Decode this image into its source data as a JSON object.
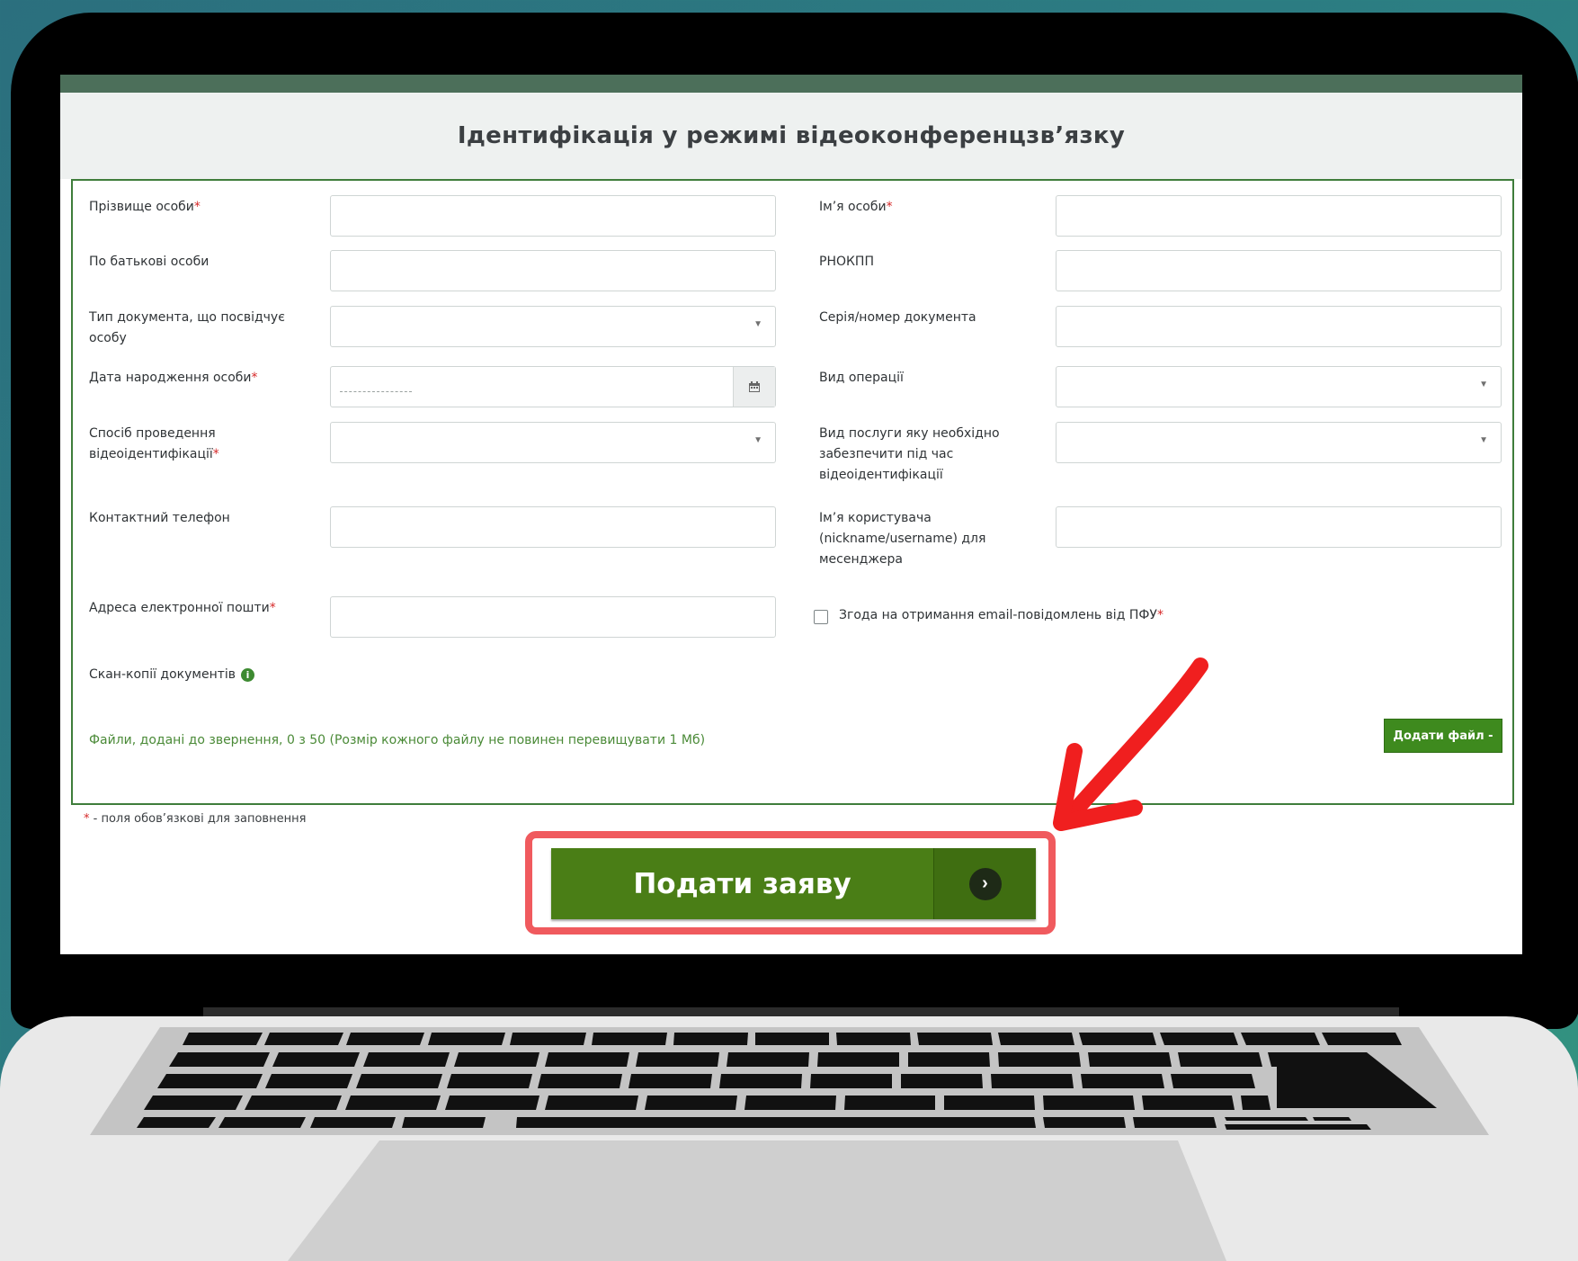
{
  "page": {
    "title": "Ідентифікація у режимі відеоконференцзв’язку"
  },
  "form": {
    "surname_label": "Прізвище особи",
    "first_name_label": "Ім’я особи",
    "patronymic_label": "По батькові особи",
    "rnokpp_label": "РНОКПП",
    "doc_type_label_1": "Тип документа, що посвідчує",
    "doc_type_label_2": "особу",
    "doc_number_label": "Серія/номер документа",
    "birth_date_label": "Дата народження особи",
    "operation_type_label": "Вид операції",
    "method_label_1": "Спосіб проведення",
    "method_label_2": "відеоідентифікації",
    "service_label_1": "Вид послуги яку необхідно",
    "service_label_2": "забезпечити під час",
    "service_label_3": "відеоідентифікації",
    "phone_label": "Контактний телефон",
    "username_label_1": "Ім’я користувача",
    "username_label_2": "(nickname/username) для",
    "username_label_3": "месенджера",
    "email_label": "Адреса електронної пошти",
    "consent_label": "Згода на отримання email-повідомлень від ПФУ",
    "scans_label": "Скан-копії документів",
    "files_info": "Файли, додані до звернення, 0 з 50 (Розмір кожного файлу не повинен перевищувати 1 Мб)",
    "add_file_label": "Додати файл -",
    "required_marker": "*",
    "required_note": " - поля обов’язкові для заповнення"
  },
  "submit": {
    "label": "Подати заяву"
  },
  "icons": {
    "info": "info-icon",
    "calendar": "calendar-icon",
    "dropdown": "chevron-down-icon",
    "submit_arrow": "chevron-right-icon",
    "annotation": "red-arrow-icon"
  },
  "colors": {
    "accent_green": "#4a7e16",
    "border_green": "#3f7d3b",
    "highlight_red": "#f05a5e",
    "required_red": "#d62828",
    "background_teal": "#2c7f83"
  }
}
